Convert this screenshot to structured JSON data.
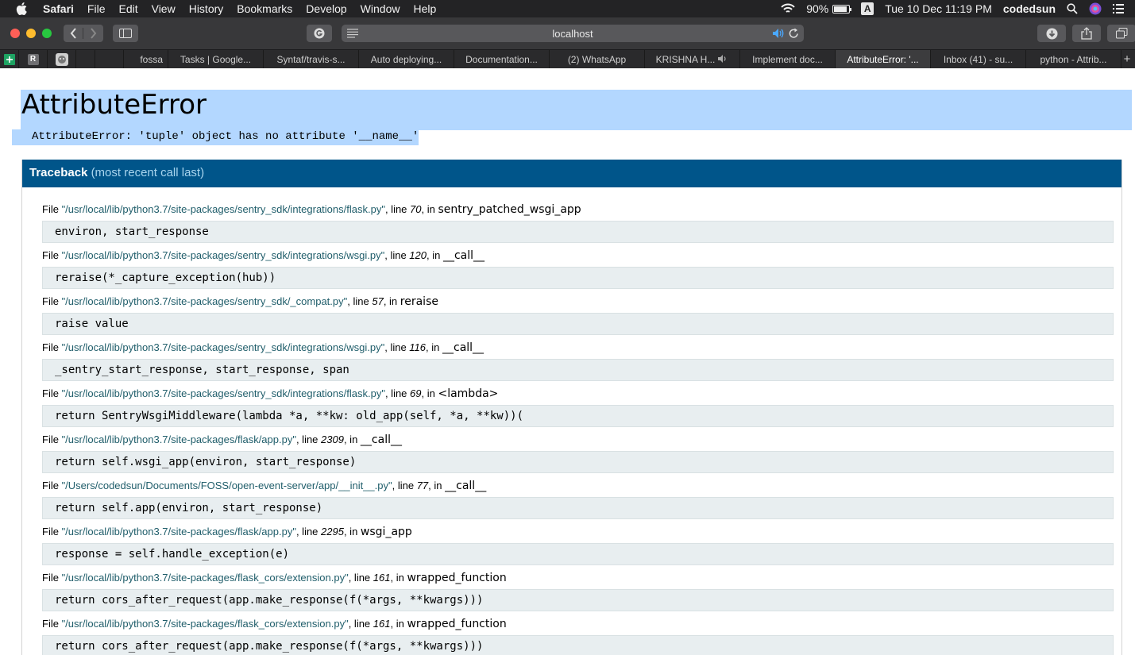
{
  "menubar": {
    "items": [
      "Safari",
      "File",
      "Edit",
      "View",
      "History",
      "Bookmarks",
      "Develop",
      "Window",
      "Help"
    ],
    "battery_percent": "90%",
    "battery_level": 0.9,
    "input_source": "A",
    "datetime": "Tue 10 Dec  11:19 PM",
    "user": "codedsun"
  },
  "toolbar": {
    "url": "localhost"
  },
  "tabs": [
    {
      "label": "fossa",
      "active": false
    },
    {
      "label": "Tasks | Google...",
      "active": false
    },
    {
      "label": "Syntaf/travis-s...",
      "active": false
    },
    {
      "label": "Auto deploying...",
      "active": false
    },
    {
      "label": "Documentation...",
      "active": false
    },
    {
      "label": "(2) WhatsApp",
      "active": false
    },
    {
      "label": "KRISHNA H...",
      "active": false,
      "audio": true
    },
    {
      "label": "Implement doc...",
      "active": false
    },
    {
      "label": "AttributeError: '...",
      "active": true
    },
    {
      "label": "Inbox (41) - su...",
      "active": false
    },
    {
      "label": "python - Attrib...",
      "active": false
    }
  ],
  "error": {
    "title": "AttributeError",
    "message": "AttributeError: 'tuple' object has no attribute '__name__'"
  },
  "traceback": {
    "heading": "Traceback",
    "subheading": "(most recent call last)",
    "frames": [
      {
        "file": "\"/usr/local/lib/python3.7/site-packages/sentry_sdk/integrations/flask.py\"",
        "line": "70",
        "func": "sentry_patched_wsgi_app",
        "code": "environ, start_response"
      },
      {
        "file": "\"/usr/local/lib/python3.7/site-packages/sentry_sdk/integrations/wsgi.py\"",
        "line": "120",
        "func": "__call__",
        "code": "reraise(*_capture_exception(hub))"
      },
      {
        "file": "\"/usr/local/lib/python3.7/site-packages/sentry_sdk/_compat.py\"",
        "line": "57",
        "func": "reraise",
        "code": "raise value"
      },
      {
        "file": "\"/usr/local/lib/python3.7/site-packages/sentry_sdk/integrations/wsgi.py\"",
        "line": "116",
        "func": "__call__",
        "code": "_sentry_start_response, start_response, span"
      },
      {
        "file": "\"/usr/local/lib/python3.7/site-packages/sentry_sdk/integrations/flask.py\"",
        "line": "69",
        "func": "<lambda>",
        "code": "return SentryWsgiMiddleware(lambda *a, **kw: old_app(self, *a, **kw))("
      },
      {
        "file": "\"/usr/local/lib/python3.7/site-packages/flask/app.py\"",
        "line": "2309",
        "func": "__call__",
        "code": "return self.wsgi_app(environ, start_response)"
      },
      {
        "file": "\"/Users/codedsun/Documents/FOSS/open-event-server/app/__init__.py\"",
        "line": "77",
        "func": "__call__",
        "code": "return self.app(environ, start_response)"
      },
      {
        "file": "\"/usr/local/lib/python3.7/site-packages/flask/app.py\"",
        "line": "2295",
        "func": "wsgi_app",
        "code": "response = self.handle_exception(e)"
      },
      {
        "file": "\"/usr/local/lib/python3.7/site-packages/flask_cors/extension.py\"",
        "line": "161",
        "func": "wrapped_function",
        "code": "return cors_after_request(app.make_response(f(*args, **kwargs)))"
      },
      {
        "file": "\"/usr/local/lib/python3.7/site-packages/flask_cors/extension.py\"",
        "line": "161",
        "func": "wrapped_function",
        "code": "return cors_after_request(app.make_response(f(*args, **kwargs)))"
      }
    ]
  }
}
